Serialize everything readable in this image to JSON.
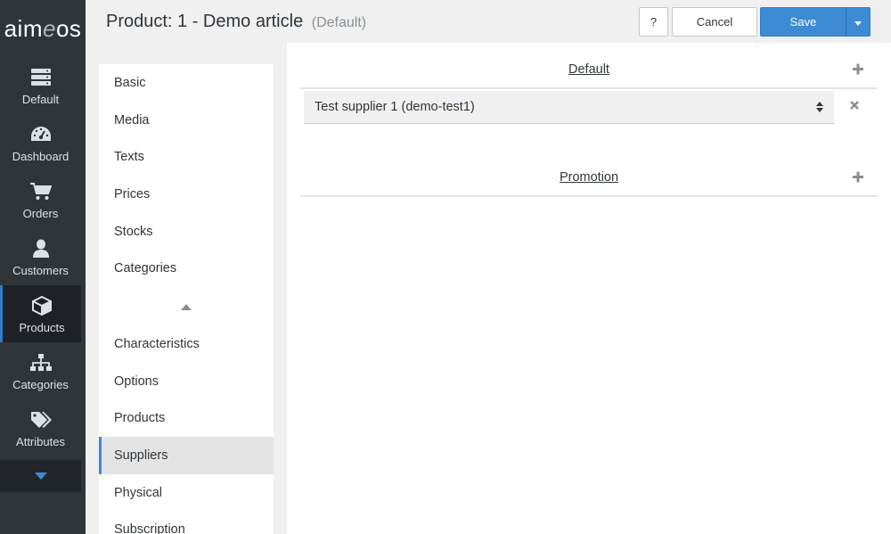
{
  "sidebar": {
    "logo": {
      "part1": "aim",
      "part2": "e",
      "part3": "os"
    },
    "items": [
      {
        "label": "Default",
        "icon": "server-icon"
      },
      {
        "label": "Dashboard",
        "icon": "dashboard-icon"
      },
      {
        "label": "Orders",
        "icon": "cart-icon"
      },
      {
        "label": "Customers",
        "icon": "user-icon"
      },
      {
        "label": "Products",
        "icon": "cube-icon",
        "active": true
      },
      {
        "label": "Categories",
        "icon": "sitemap-icon"
      },
      {
        "label": "Attributes",
        "icon": "tags-icon"
      }
    ],
    "more_icon": "caret-down-icon"
  },
  "header": {
    "title": "Product: 1 - Demo article",
    "subtitle": "(Default)",
    "help_label": "?",
    "cancel_label": "Cancel",
    "save_label": "Save"
  },
  "tabs": {
    "items_top": [
      "Basic",
      "Media",
      "Texts",
      "Prices",
      "Stocks",
      "Categories"
    ],
    "items_bottom": [
      "Characteristics",
      "Options",
      "Products",
      "Suppliers",
      "Physical",
      "Subscription"
    ],
    "active": "Suppliers"
  },
  "main": {
    "groups": [
      {
        "title": "Default",
        "entries": [
          {
            "value": "Test supplier 1 (demo-test1)"
          }
        ]
      },
      {
        "title": "Promotion",
        "entries": []
      }
    ]
  },
  "colors": {
    "sidebar_bg": "#30353a",
    "accent": "#3d8bd2",
    "page_bg": "#f0f0f0"
  }
}
